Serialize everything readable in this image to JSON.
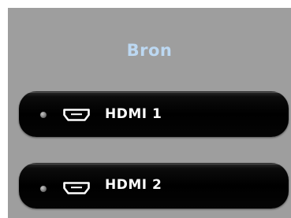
{
  "menu": {
    "title": "Bron",
    "sources": [
      {
        "label": "HDMI 1",
        "icon": "hdmi-port-icon",
        "indicator": "inactive"
      },
      {
        "label": "HDMI 2",
        "icon": "hdmi-port-icon",
        "indicator": "inactive"
      }
    ]
  },
  "colors": {
    "panel_background": "#9e9e9e",
    "title_text": "#bcd8f2",
    "button_background": "#000000",
    "button_text": "#ffffff"
  }
}
